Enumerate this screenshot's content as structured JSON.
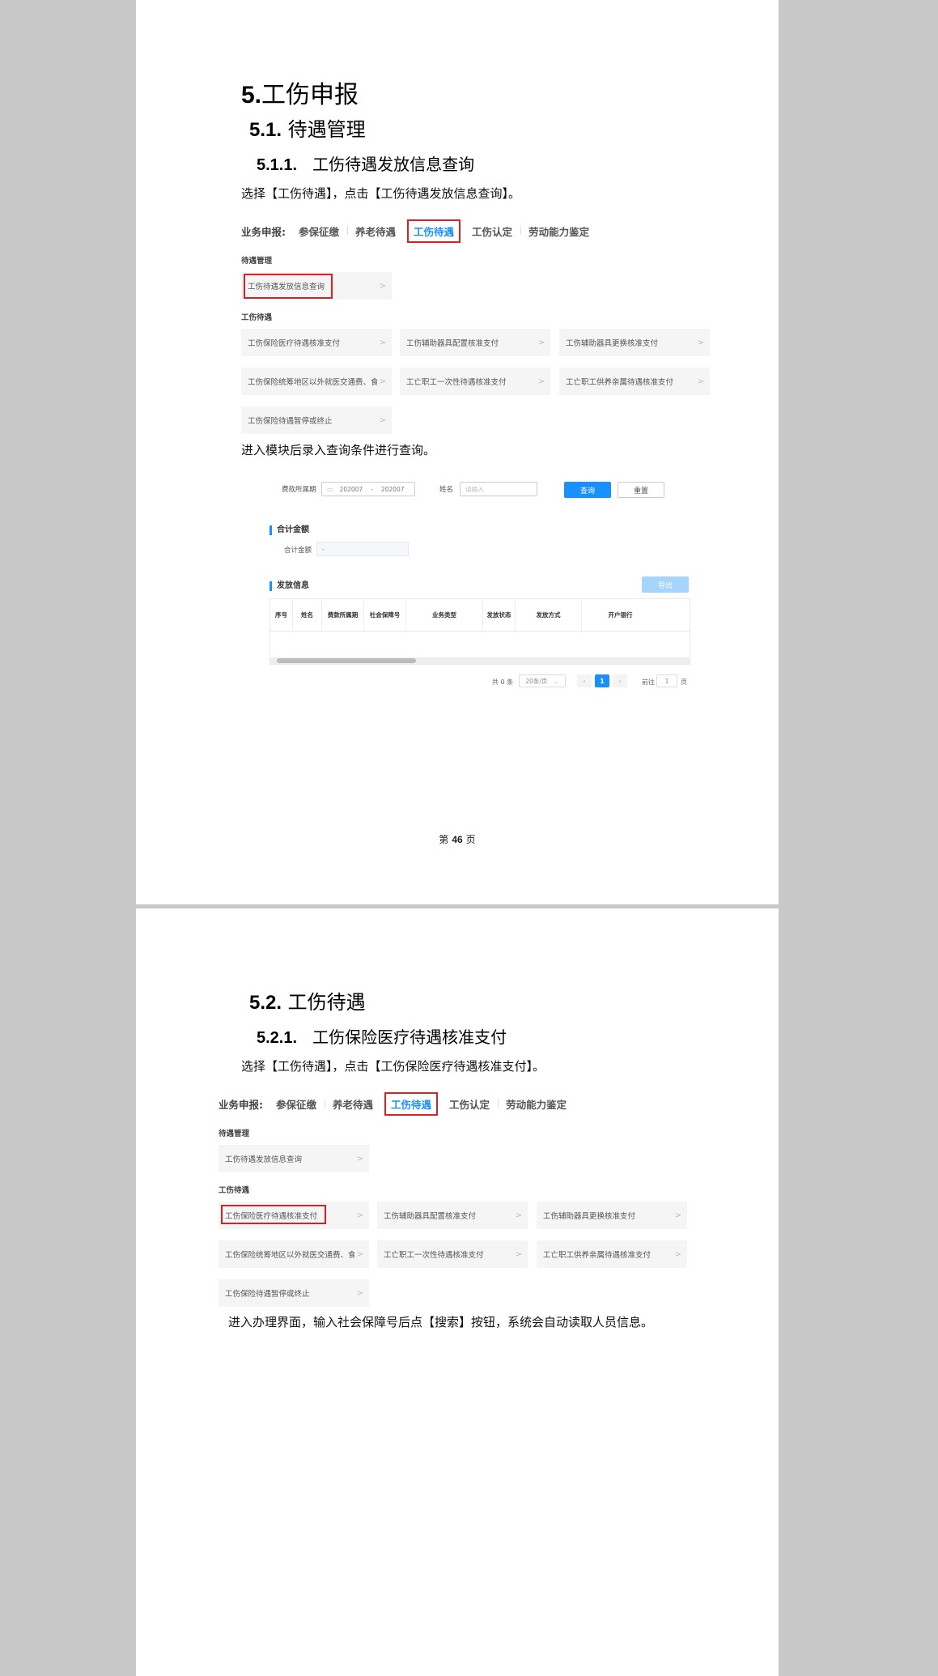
{
  "page1": {
    "h1_num": "5.",
    "h1_text": "工伤申报",
    "h2_num": "5.1.",
    "h2_text": "待遇管理",
    "h3_num": "5.1.1.",
    "h3_text": "工伤待遇发放信息查询",
    "para1": "选择【工伤待遇】，点击【工伤待遇发放信息查询】。",
    "para2": "进入模块后录入查询条件进行查询。",
    "footer_prefix": "第",
    "footer_num": "46",
    "footer_suffix": "页"
  },
  "nav": {
    "prefix": "业务申报:",
    "items": [
      "参保征缴",
      "养老待遇",
      "工伤待遇",
      "工伤认定",
      "劳动能力鉴定"
    ],
    "active": "工伤待遇"
  },
  "menu": {
    "section1": "待遇管理",
    "section1_items": [
      "工伤待遇发放信息查询"
    ],
    "section2": "工伤待遇",
    "section2_items": [
      "工伤保险医疗待遇核准支付",
      "工伤辅助器具配置核准支付",
      "工伤辅助器具更换核准支付",
      "工伤保险统筹地区以外就医交通费、食宿...",
      "工亡职工一次性待遇核准支付",
      "工亡职工供养亲属待遇核准支付",
      "工伤保险待遇暂停或终止"
    ],
    "chevron": ">"
  },
  "query": {
    "period_label": "费款所属期",
    "date_from": "202007",
    "date_sep": "-",
    "date_to": "202007",
    "name_label": "姓名",
    "name_placeholder": "请输入",
    "search_button": "查询",
    "reset_button": "重置",
    "total_title": "合计金额",
    "total_label": "合计金额",
    "total_value": "-",
    "issue_title": "发放信息",
    "export_button": "导出",
    "columns": [
      "序号",
      "姓名",
      "费款所属期",
      "社会保障号",
      "业务类型",
      "发放状态",
      "发放方式",
      "开户银行"
    ],
    "total_count": "共 0 条",
    "page_size": "20条/页",
    "current_page": "1",
    "goto_label": "前往",
    "goto_value": "1",
    "page_unit": "页"
  },
  "page2": {
    "h2_num": "5.2.",
    "h2_text": "工伤待遇",
    "h3_num": "5.2.1.",
    "h3_text": "工伤保险医疗待遇核准支付",
    "para1": "选择【工伤待遇】，点击【工伤保险医疗待遇核准支付】。",
    "para2": "进入办理界面，输入社会保障号后点【搜索】按钮，系统会自动读取人员信息。"
  },
  "colors": {
    "accent": "#1890ff",
    "highlight": "#e02020"
  }
}
